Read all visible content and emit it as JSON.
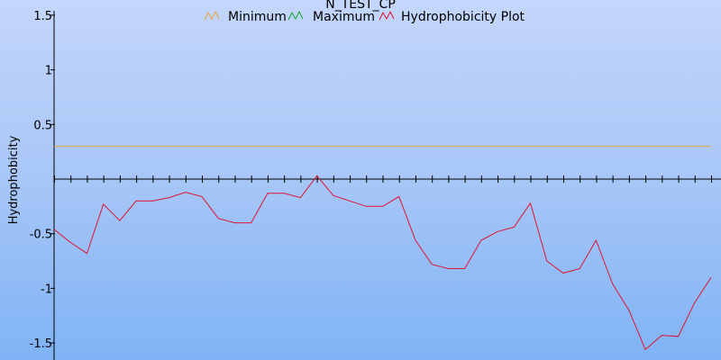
{
  "chart_data": {
    "type": "line",
    "title": "N_TEST_CP",
    "ylabel": "Hydrophobicity",
    "xlabel": "",
    "ylim": [
      -1.55,
      1.55
    ],
    "yticks": [
      -1.5,
      -1,
      -0.5,
      0.5,
      1,
      1.5
    ],
    "ytick_labels": [
      "-1.5",
      "-1",
      "-0.5",
      "0.5",
      "1",
      "1.5"
    ],
    "x_count": 41,
    "legend_position": "top",
    "series": [
      {
        "name": "Minimum",
        "color": "#e8a33a",
        "values": [
          0.3
        ]
      },
      {
        "name": "Maximum",
        "color": "#13a12a",
        "values": []
      },
      {
        "name": "Hydrophobicity Plot",
        "color": "#e0142e",
        "values": [
          -0.46,
          -0.58,
          -0.68,
          -0.23,
          -0.38,
          -0.2,
          -0.2,
          -0.17,
          -0.12,
          -0.16,
          -0.36,
          -0.4,
          -0.4,
          -0.13,
          -0.13,
          -0.17,
          0.03,
          -0.15,
          -0.2,
          -0.25,
          -0.25,
          -0.16,
          -0.56,
          -0.78,
          -0.82,
          -0.82,
          -0.56,
          -0.48,
          -0.44,
          -0.22,
          -0.75,
          -0.86,
          -0.82,
          -0.56,
          -0.96,
          -1.2,
          -1.56,
          -1.43,
          -1.44,
          -1.13,
          -0.9
        ]
      }
    ]
  }
}
